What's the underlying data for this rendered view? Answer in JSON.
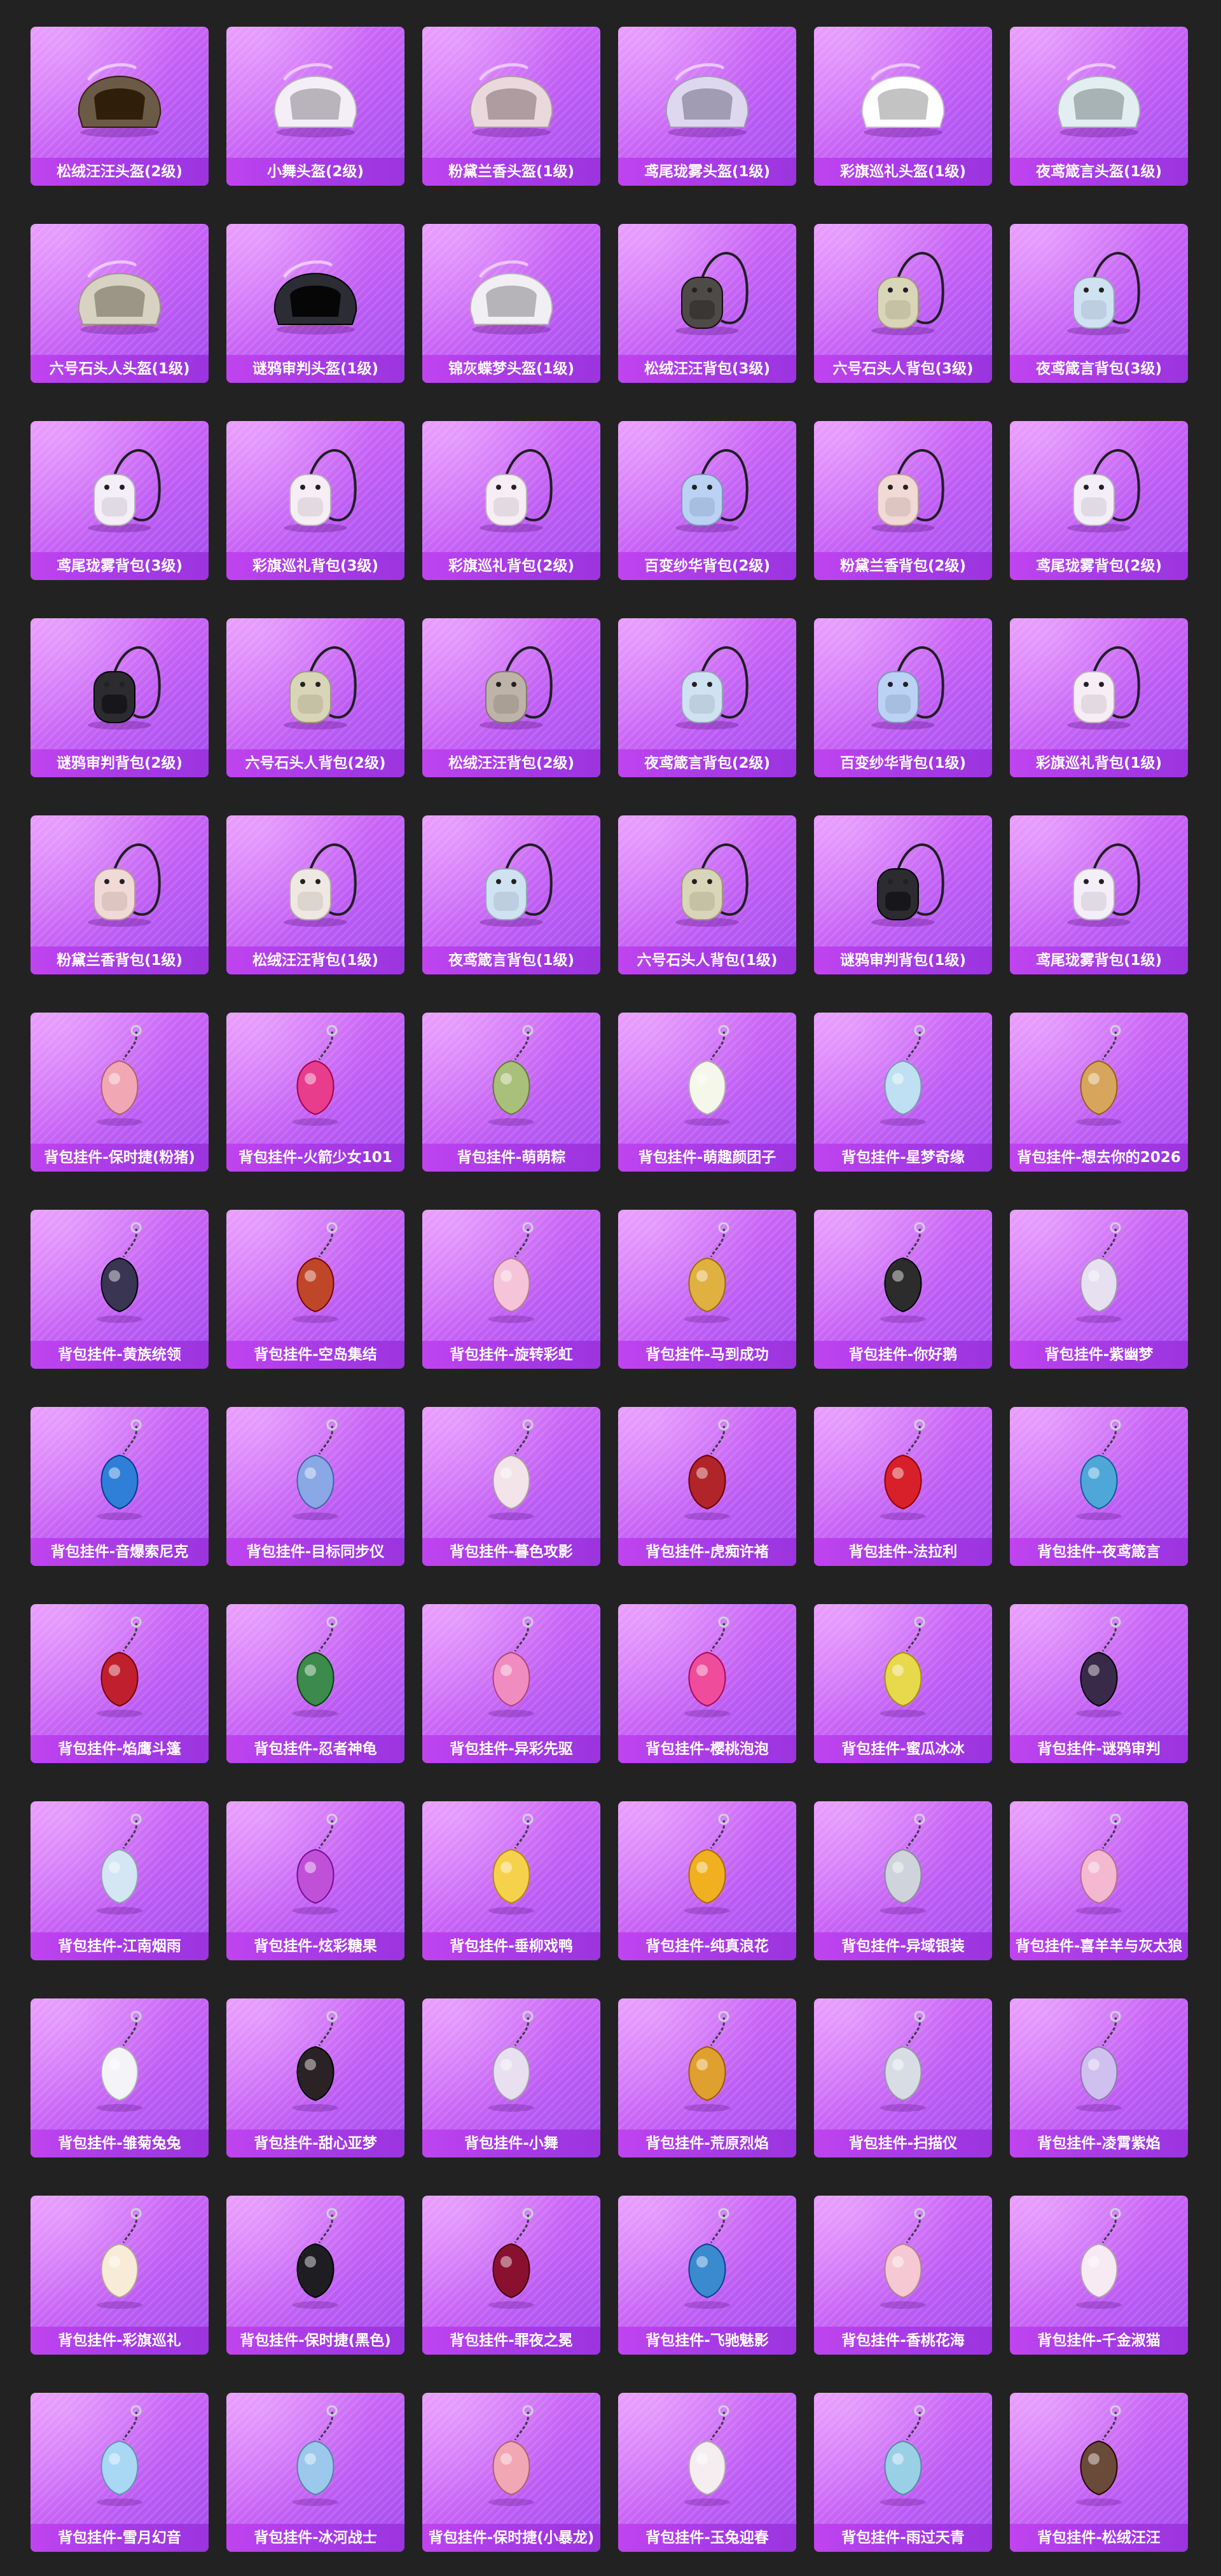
{
  "items": [
    {
      "label": "松绒汪汪头盔(2级)",
      "icon": "helmet-icon",
      "color": "#6b5a45"
    },
    {
      "label": "小舞头盔(2级)",
      "icon": "helmet-icon",
      "color": "#f4eef6"
    },
    {
      "label": "粉黛兰香头盔(1级)",
      "icon": "helmet-icon",
      "color": "#e9d8dc"
    },
    {
      "label": "鸢尾珑雾头盔(1级)",
      "icon": "helmet-icon",
      "color": "#ddd8ee"
    },
    {
      "label": "彩旗巡礼头盔(1级)",
      "icon": "helmet-icon",
      "color": "#ffffff"
    },
    {
      "label": "夜鸢箴言头盔(1级)",
      "icon": "helmet-icon",
      "color": "#e2eef0"
    },
    {
      "label": "六号石头人头盔(1级)",
      "icon": "helmet-icon",
      "color": "#d8d2c2"
    },
    {
      "label": "谜鸦审判头盔(1级)",
      "icon": "helmet-icon",
      "color": "#2c2c34"
    },
    {
      "label": "锦灰蝶梦头盔(1级)",
      "icon": "helmet-icon",
      "color": "#f1eef4"
    },
    {
      "label": "松绒汪汪背包(3级)",
      "icon": "backpack-icon",
      "color": "#4e4a48"
    },
    {
      "label": "六号石头人背包(3级)",
      "icon": "backpack-icon",
      "color": "#d9d5b9"
    },
    {
      "label": "夜鸢箴言背包(3级)",
      "icon": "backpack-icon",
      "color": "#cfe2f2"
    },
    {
      "label": "鸢尾珑雾背包(3级)",
      "icon": "backpack-icon",
      "color": "#f3eef7"
    },
    {
      "label": "彩旗巡礼背包(3级)",
      "icon": "backpack-icon",
      "color": "#f6eef4"
    },
    {
      "label": "彩旗巡礼背包(2级)",
      "icon": "backpack-icon",
      "color": "#f6eef4"
    },
    {
      "label": "百变纱华背包(2级)",
      "icon": "backpack-icon",
      "color": "#bcd2f4"
    },
    {
      "label": "粉黛兰香背包(2级)",
      "icon": "backpack-icon",
      "color": "#f1d9d6"
    },
    {
      "label": "鸢尾珑雾背包(2级)",
      "icon": "backpack-icon",
      "color": "#f3eef7"
    },
    {
      "label": "谜鸦审判背包(2级)",
      "icon": "backpack-icon",
      "color": "#2b2b30"
    },
    {
      "label": "六号石头人背包(2级)",
      "icon": "backpack-icon",
      "color": "#d9d5b9"
    },
    {
      "label": "松绒汪汪背包(2级)",
      "icon": "backpack-icon",
      "color": "#bdb3a8"
    },
    {
      "label": "夜鸢箴言背包(2级)",
      "icon": "backpack-icon",
      "color": "#cfe2f2"
    },
    {
      "label": "百变纱华背包(1级)",
      "icon": "backpack-icon",
      "color": "#bcd2f4"
    },
    {
      "label": "彩旗巡礼背包(1级)",
      "icon": "backpack-icon",
      "color": "#f6eef4"
    },
    {
      "label": "粉黛兰香背包(1级)",
      "icon": "backpack-icon",
      "color": "#f1d9d6"
    },
    {
      "label": "松绒汪汪背包(1级)",
      "icon": "backpack-icon",
      "color": "#efe8e2"
    },
    {
      "label": "夜鸢箴言背包(1级)",
      "icon": "backpack-icon",
      "color": "#cfe2f2"
    },
    {
      "label": "六号石头人背包(1级)",
      "icon": "backpack-icon",
      "color": "#d9d5b9"
    },
    {
      "label": "谜鸦审判背包(1级)",
      "icon": "backpack-icon",
      "color": "#2b2b30"
    },
    {
      "label": "鸢尾珑雾背包(1级)",
      "icon": "backpack-icon",
      "color": "#f3eef7"
    },
    {
      "label": "背包挂件-保时捷(粉猪)",
      "icon": "charm-icon",
      "color": "#f2a7b4"
    },
    {
      "label": "背包挂件-火箭少女101",
      "icon": "charm-icon",
      "color": "#e83c8c"
    },
    {
      "label": "背包挂件-萌萌粽",
      "icon": "charm-icon",
      "color": "#a8c07a"
    },
    {
      "label": "背包挂件-萌趣颜团子",
      "icon": "charm-icon",
      "color": "#f4f7ea"
    },
    {
      "label": "背包挂件-星梦奇缘",
      "icon": "charm-icon",
      "color": "#bfe0f2"
    },
    {
      "label": "背包挂件-想去你的2026",
      "icon": "charm-icon",
      "color": "#d7a65c"
    },
    {
      "label": "背包挂件-黄族统领",
      "icon": "charm-icon",
      "color": "#3a3552"
    },
    {
      "label": "背包挂件-空岛集结",
      "icon": "charm-icon",
      "color": "#c0462a"
    },
    {
      "label": "背包挂件-旋转彩虹",
      "icon": "charm-icon",
      "color": "#f6c4d8"
    },
    {
      "label": "背包挂件-马到成功",
      "icon": "charm-icon",
      "color": "#e0b040"
    },
    {
      "label": "背包挂件-你好鹅",
      "icon": "charm-icon",
      "color": "#2c2c2c"
    },
    {
      "label": "背包挂件-紫幽梦",
      "icon": "charm-icon",
      "color": "#e6e0f0"
    },
    {
      "label": "背包挂件-音爆索尼克",
      "icon": "charm-icon",
      "color": "#2f7fd8"
    },
    {
      "label": "背包挂件-目标同步仪",
      "icon": "charm-icon",
      "color": "#8aa8e6"
    },
    {
      "label": "背包挂件-暮色攻影",
      "icon": "charm-icon",
      "color": "#f2e4e8"
    },
    {
      "label": "背包挂件-虎痴许褚",
      "icon": "charm-icon",
      "color": "#b0242a"
    },
    {
      "label": "背包挂件-法拉利",
      "icon": "charm-icon",
      "color": "#d8202a"
    },
    {
      "label": "背包挂件-夜鸢箴言",
      "icon": "charm-icon",
      "color": "#4fa6d8"
    },
    {
      "label": "背包挂件-焰鹰斗篷",
      "icon": "charm-icon",
      "color": "#c0202e"
    },
    {
      "label": "背包挂件-忍者神龟",
      "icon": "charm-icon",
      "color": "#3c8a4c"
    },
    {
      "label": "背包挂件-异彩先驱",
      "icon": "charm-icon",
      "color": "#f08cc0"
    },
    {
      "label": "背包挂件-樱桃泡泡",
      "icon": "charm-icon",
      "color": "#f04c9c"
    },
    {
      "label": "背包挂件-蜜瓜冰冰",
      "icon": "charm-icon",
      "color": "#e8d84c"
    },
    {
      "label": "背包挂件-谜鸦审判",
      "icon": "charm-icon",
      "color": "#3a2a4a"
    },
    {
      "label": "背包挂件-江南烟雨",
      "icon": "charm-icon",
      "color": "#d4e6f4"
    },
    {
      "label": "背包挂件-炫彩糖果",
      "icon": "charm-icon",
      "color": "#c050d8"
    },
    {
      "label": "背包挂件-垂柳戏鸭",
      "icon": "charm-icon",
      "color": "#f6d24c"
    },
    {
      "label": "背包挂件-纯真浪花",
      "icon": "charm-icon",
      "color": "#f0b020"
    },
    {
      "label": "背包挂件-异域银装",
      "icon": "charm-icon",
      "color": "#cfd3dc"
    },
    {
      "label": "背包挂件-喜羊羊与灰太狼",
      "icon": "charm-icon",
      "color": "#f4b8d0"
    },
    {
      "label": "背包挂件-雏菊兔兔",
      "icon": "charm-icon",
      "color": "#f4f4f8"
    },
    {
      "label": "背包挂件-甜心亚梦",
      "icon": "charm-icon",
      "color": "#2a2224"
    },
    {
      "label": "背包挂件-小舞",
      "icon": "charm-icon",
      "color": "#e8e0f0"
    },
    {
      "label": "背包挂件-荒原烈焰",
      "icon": "charm-icon",
      "color": "#e0a030"
    },
    {
      "label": "背包挂件-扫描仪",
      "icon": "charm-icon",
      "color": "#d8dce4"
    },
    {
      "label": "背包挂件-凌霄紫焰",
      "icon": "charm-icon",
      "color": "#d0c0f0"
    },
    {
      "label": "背包挂件-彩旗巡礼",
      "icon": "charm-icon",
      "color": "#f8ecd8"
    },
    {
      "label": "背包挂件-保时捷(黑色)",
      "icon": "charm-icon",
      "color": "#1e1e22"
    },
    {
      "label": "背包挂件-罪夜之冕",
      "icon": "charm-icon",
      "color": "#8a1030"
    },
    {
      "label": "背包挂件-飞驰魅影",
      "icon": "charm-icon",
      "color": "#3a8ad0"
    },
    {
      "label": "背包挂件-香桃花海",
      "icon": "charm-icon",
      "color": "#f6c8d4"
    },
    {
      "label": "背包挂件-千金淑猫",
      "icon": "charm-icon",
      "color": "#f8eaf2"
    },
    {
      "label": "背包挂件-雪月幻音",
      "icon": "charm-icon",
      "color": "#a8d8f4"
    },
    {
      "label": "背包挂件-冰河战士",
      "icon": "charm-icon",
      "color": "#9cc8ec"
    },
    {
      "label": "背包挂件-保时捷(小暴龙)",
      "icon": "charm-icon",
      "color": "#f2a7b4"
    },
    {
      "label": "背包挂件-玉兔迎春",
      "icon": "charm-icon",
      "color": "#f4eef0"
    },
    {
      "label": "背包挂件-雨过天青",
      "icon": "charm-icon",
      "color": "#9ad0e6"
    },
    {
      "label": "背包挂件-松绒汪汪",
      "icon": "charm-icon",
      "color": "#6a4a38"
    }
  ]
}
